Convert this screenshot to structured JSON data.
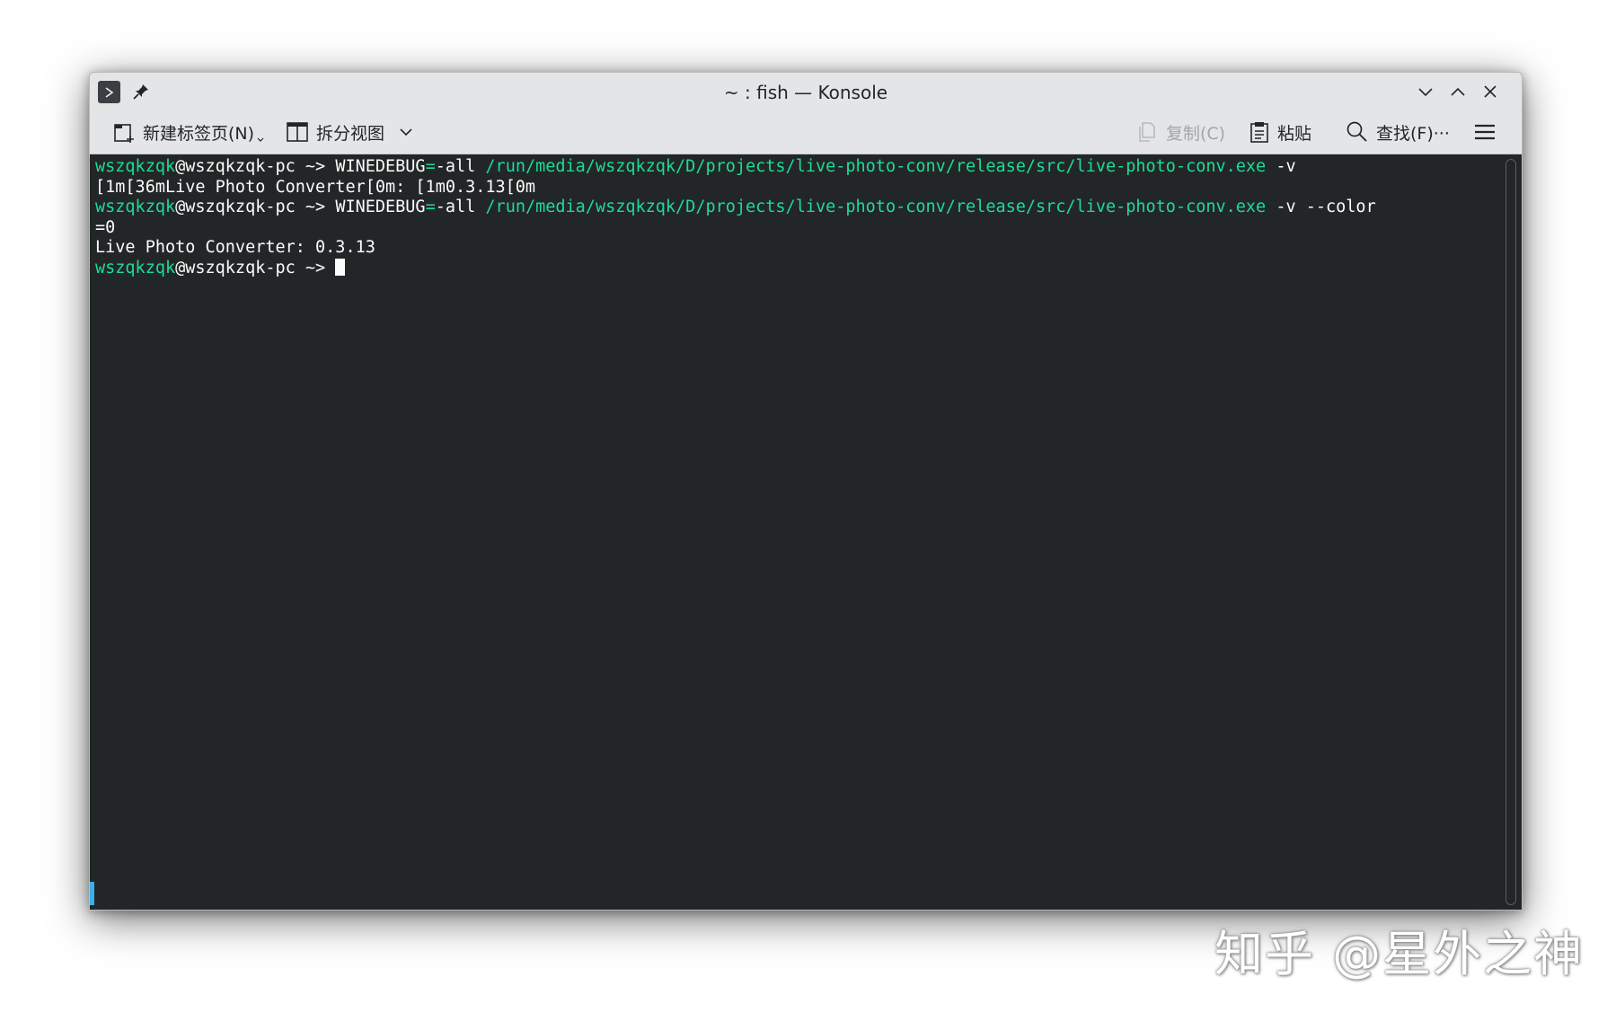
{
  "window": {
    "title": "~ : fish — Konsole"
  },
  "toolbar": {
    "new_tab": "新建标签页(N)",
    "split_view": "拆分视图",
    "copy": "复制(C)",
    "paste": "粘贴",
    "find": "查找(F)···"
  },
  "terminal": {
    "user": "wszqkzqk",
    "host_suffix": "@wszqkzqk-pc",
    "prompt": " ~> ",
    "env_name": "WINEDEBUG",
    "env_eq": "=",
    "env_value": "-all",
    "exe_path": "/run/media/wszqkzqk/D/projects/live-photo-conv/release/src/live-photo-conv.exe",
    "cmd1_args": " -v",
    "output1": "[1m[36mLive Photo Converter[0m: [1m0.3.13[0m",
    "cmd2_args": " -v --color",
    "cmd2_wrap": "=0",
    "output2": "Live Photo Converter: 0.3.13"
  },
  "watermark": "知乎 @星外之神",
  "icons": [
    "konsole-app-icon",
    "pin-icon",
    "minimize-icon",
    "maximize-icon",
    "close-icon",
    "new-tab-icon",
    "split-view-icon",
    "chevron-down-icon",
    "copy-icon",
    "paste-icon",
    "search-icon",
    "hamburger-menu-icon"
  ],
  "colors": {
    "terminal_bg": "#232627",
    "terminal_fg": "#fcfcfc",
    "prompt_green": "#1cdc9a",
    "accent": "#3daee9"
  }
}
